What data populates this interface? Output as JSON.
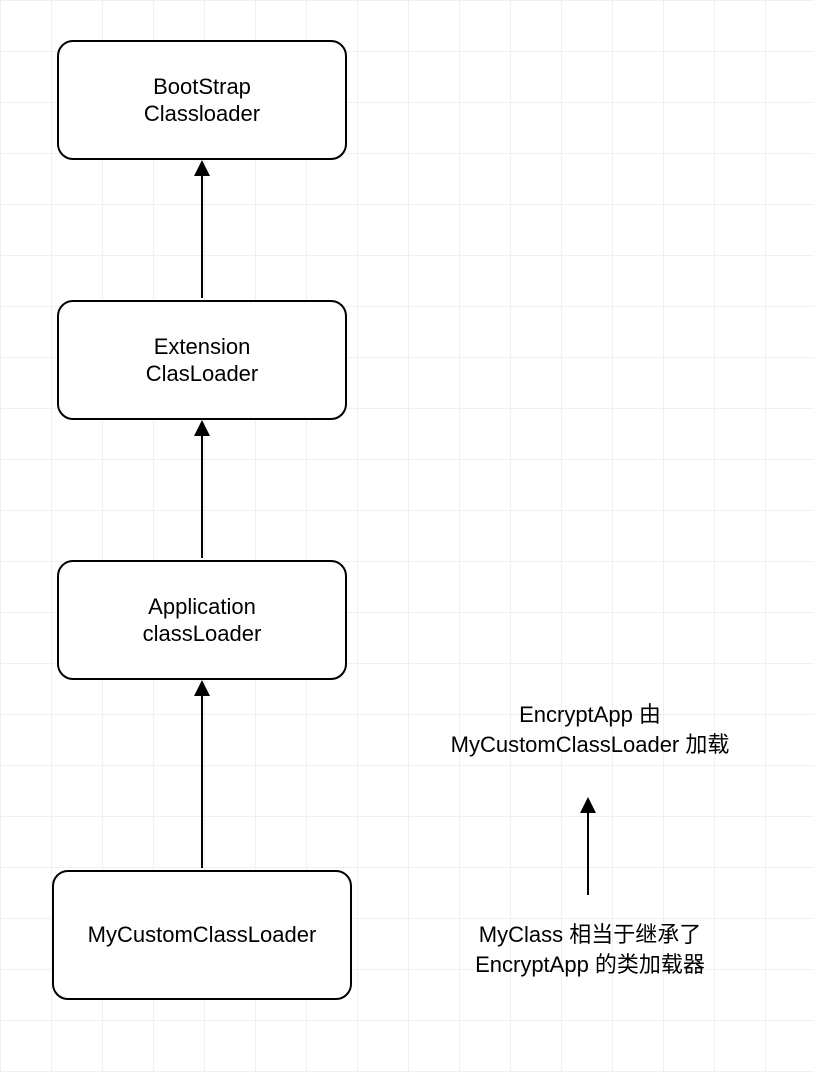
{
  "nodes": {
    "bootstrap": {
      "line1": "BootStrap",
      "line2": "Classloader"
    },
    "extension": {
      "line1": "Extension",
      "line2": "ClasLoader"
    },
    "application": {
      "line1": "Application",
      "line2": "classLoader"
    },
    "custom": {
      "line1": "MyCustomClassLoader"
    }
  },
  "labels": {
    "top": {
      "line1": "EncryptApp 由",
      "line2": "MyCustomClassLoader 加载"
    },
    "bottom": {
      "line1": "MyClass 相当于继承了",
      "line2": "EncryptApp 的类加载器"
    }
  },
  "fontSizes": {
    "node": 22,
    "label": 22
  }
}
